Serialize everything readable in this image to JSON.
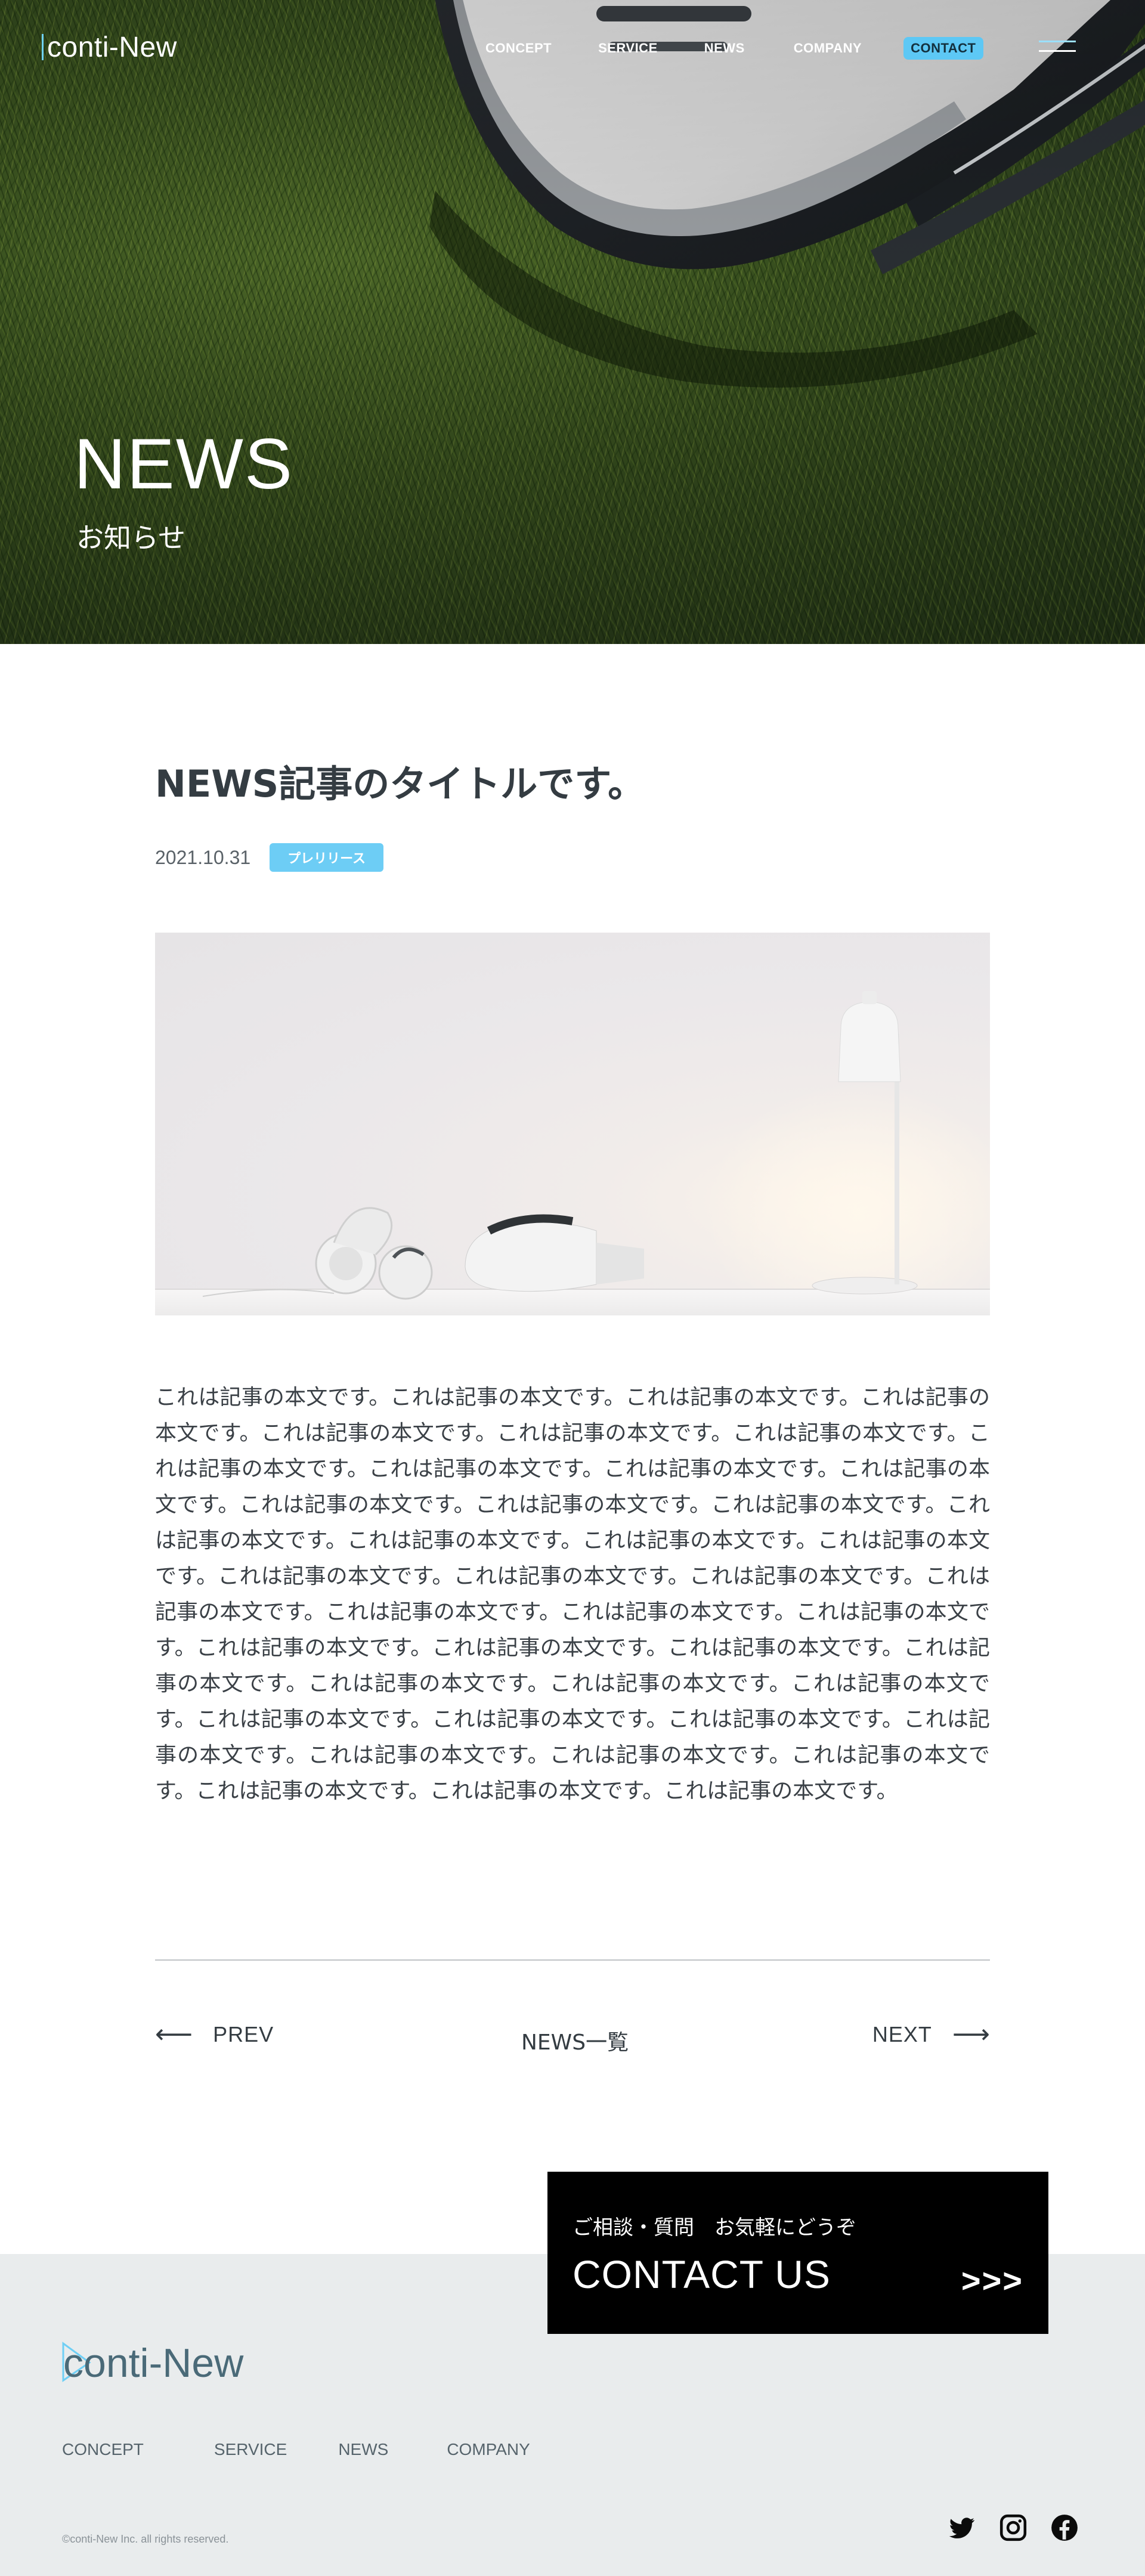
{
  "header": {
    "logo": "conti-New",
    "nav": [
      {
        "label": "CONCEPT"
      },
      {
        "label": "SERVICE"
      },
      {
        "label": "NEWS"
      },
      {
        "label": "COMPANY"
      },
      {
        "label": "CONTACT"
      }
    ],
    "menu_icon": "hamburger-menu-icon"
  },
  "hero": {
    "title": "NEWS",
    "subtitle": "お知らせ"
  },
  "article": {
    "title": "NEWS記事のタイトルです。",
    "date": "2021.10.31",
    "category": "プレリリース",
    "body": "これは記事の本文です。これは記事の本文です。これは記事の本文です。これは記事の本文です。これは記事の本文です。これは記事の本文です。これは記事の本文です。これは記事の本文です。これは記事の本文です。これは記事の本文です。これは記事の本文です。これは記事の本文です。これは記事の本文です。これは記事の本文です。これは記事の本文です。これは記事の本文です。これは記事の本文です。これは記事の本文です。これは記事の本文です。これは記事の本文です。これは記事の本文です。これは記事の本文です。これは記事の本文です。これは記事の本文です。これは記事の本文です。これは記事の本文です。これは記事の本文です。これは記事の本文です。これは記事の本文です。これは記事の本文です。これは記事の本文です。これは記事の本文です。これは記事の本文です。これは記事の本文です。これは記事の本文です。これは記事の本文です。これは記事の本文です。これは記事の本文です。これは記事の本文です。これは記事の本文です。これは記事の本文です。これは記事の本文です。"
  },
  "pager": {
    "prev": "PREV",
    "index": "NEWS一覧",
    "next": "NEXT"
  },
  "contact_cta": {
    "sub": "ご相談・質問　お気軽にどうぞ",
    "title": "CONTACT US",
    "arrows": ">>>"
  },
  "footer": {
    "logo": "conti-New",
    "nav": [
      {
        "label": "CONCEPT"
      },
      {
        "label": "SERVICE"
      },
      {
        "label": "NEWS"
      },
      {
        "label": "COMPANY"
      }
    ],
    "copyright": "©conti-New Inc. all rights reserved.",
    "social": [
      "twitter-icon",
      "instagram-icon",
      "facebook-icon"
    ]
  },
  "colors": {
    "accent": "#5dc8f5",
    "footer_bg": "#e9eced",
    "text": "#343c42"
  }
}
